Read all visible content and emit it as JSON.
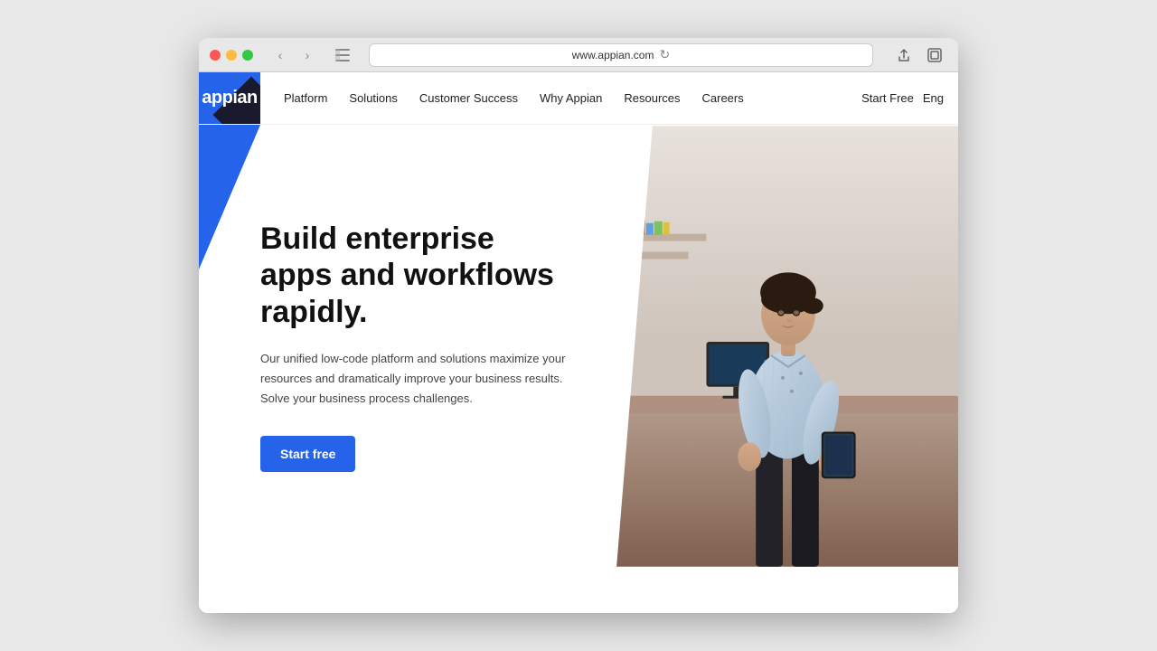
{
  "browser": {
    "url": "www.appian.com",
    "traffic_lights": [
      "close",
      "minimize",
      "maximize"
    ]
  },
  "navbar": {
    "logo_text": "appian",
    "nav_items": [
      {
        "id": "platform",
        "label": "Platform"
      },
      {
        "id": "solutions",
        "label": "Solutions"
      },
      {
        "id": "customer-success",
        "label": "Customer Success"
      },
      {
        "id": "why-appian",
        "label": "Why Appian"
      },
      {
        "id": "resources",
        "label": "Resources"
      },
      {
        "id": "careers",
        "label": "Careers"
      }
    ],
    "start_free": "Start Free",
    "language": "Eng"
  },
  "hero": {
    "title": "Build enterprise apps and workflows rapidly.",
    "subtitle": "Our unified low-code platform and solutions maximize your resources and dramatically improve your business results. Solve your business process challenges.",
    "cta_label": "Start free"
  }
}
